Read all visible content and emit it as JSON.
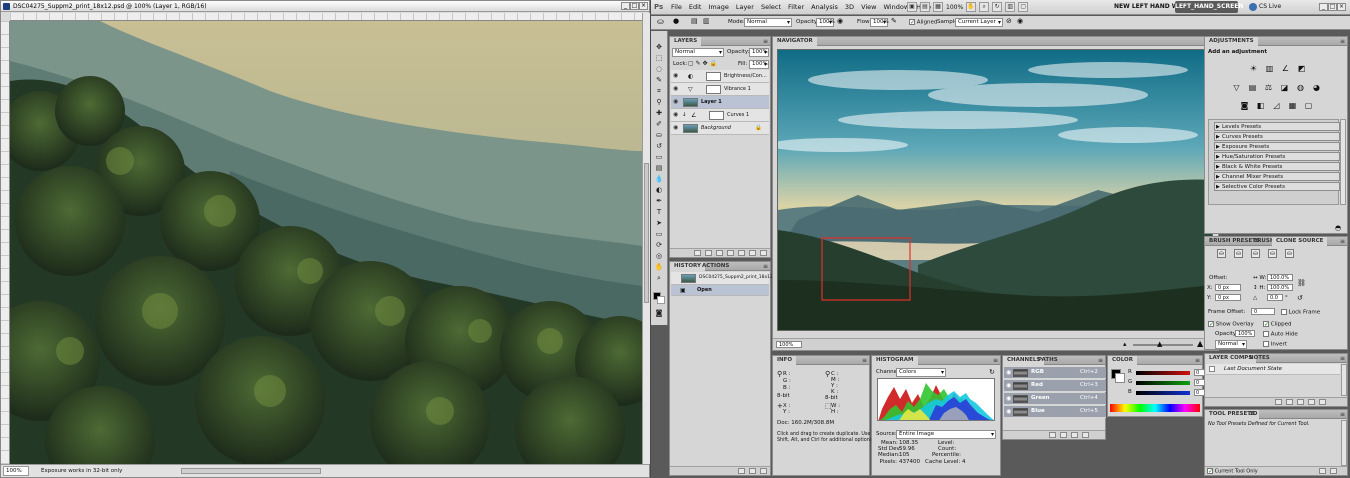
{
  "document": {
    "title": "DSC04275_Suppm2_print_18x12.psd @ 100% (Layer 1, RGB/16)",
    "min_glyph": "_",
    "max_glyph": "□",
    "close_glyph": "×",
    "zoom": "100%",
    "status": "Exposure works in 32-bit only"
  },
  "menubar": {
    "logo": "Ps",
    "items": [
      "File",
      "Edit",
      "Image",
      "Layer",
      "Select",
      "Filter",
      "Analysis",
      "3D",
      "View",
      "Window",
      "Help"
    ],
    "zoom_value": "100%",
    "workspaces": "NEW LEFT HAND WS",
    "active_workspace": "LEFT_HAND_SCREEN",
    "cs_live": "CS Live"
  },
  "options": {
    "mode_label": "Mode:",
    "mode_value": "Normal",
    "opacity_label": "Opacity:",
    "opacity_value": "100%",
    "flow_label": "Flow:",
    "flow_value": "100%",
    "aligned_label": "Aligned",
    "sample_label": "Sample:",
    "sample_value": "Current Layer"
  },
  "layers": {
    "tab": "LAYERS",
    "blend": "Normal",
    "opacity_label": "Opacity:",
    "opacity_value": "100%",
    "lock_label": "Lock:",
    "fill_label": "Fill:",
    "fill_value": "100%",
    "rows": [
      {
        "name": "Brightness/Con..."
      },
      {
        "name": "Vibrance 1"
      },
      {
        "name": "Layer 1"
      },
      {
        "name": "Curves 1"
      },
      {
        "name": "Background"
      }
    ]
  },
  "history": {
    "tab": "HISTORY",
    "tab2": "ACTIONS",
    "snapshot": "DSC04275_Suppm2_print_18x12.psd",
    "state": "Open"
  },
  "navigator": {
    "tab": "NAVIGATOR",
    "zoom": "100%"
  },
  "info": {
    "tab": "INFO",
    "labels": [
      "R :",
      "G :",
      "B :",
      "8-bit",
      "C :",
      "M :",
      "Y :",
      "K :",
      "8-bit",
      "X :",
      "Y :",
      "W :",
      "H :"
    ],
    "doc": "Doc: 160.2M/308.8M",
    "hint": [
      "Click and drag to create duplicate.  Use",
      "Shift, Alt, and Ctrl for additional options."
    ]
  },
  "histogram": {
    "tab": "HISTOGRAM",
    "channel_label": "Channel:",
    "channel_value": "Colors",
    "source_label": "Source:",
    "source_value": "Entire Image",
    "stats_left": [
      [
        "Mean:",
        "108.35"
      ],
      [
        "Std Dev:",
        "59.96"
      ],
      [
        "Median:",
        "105"
      ],
      [
        "Pixels:",
        "437400"
      ]
    ],
    "stats_right": [
      "Level:",
      "Count:",
      "Percentile:",
      "Cache Level:  4"
    ]
  },
  "channels": {
    "tab": "CHANNELS",
    "tab2": "PATHS",
    "rows": [
      {
        "name": "RGB",
        "key": "Ctrl+2"
      },
      {
        "name": "Red",
        "key": "Ctrl+3"
      },
      {
        "name": "Green",
        "key": "Ctrl+4"
      },
      {
        "name": "Blue",
        "key": "Ctrl+5"
      }
    ]
  },
  "color": {
    "tab": "COLOR",
    "labels": [
      "R",
      "G",
      "B"
    ],
    "values": [
      "0",
      "0",
      "0"
    ],
    "colors": {
      "r": "#d01010",
      "g": "#10a010",
      "b": "#1030d0"
    }
  },
  "adjustments": {
    "tab": "ADJUSTMENTS",
    "heading": "Add an adjustment",
    "icons_row1": [
      "☀",
      "▥",
      "∠",
      "◩"
    ],
    "icons_row2": [
      "▽",
      "▤",
      "⚖",
      "◪",
      "◍",
      "◕"
    ],
    "icons_row3": [
      "◙",
      "◧",
      "◿",
      "▦",
      "▢"
    ],
    "presets": [
      "Levels Presets",
      "Curves Presets",
      "Exposure Presets",
      "Hue/Saturation Presets",
      "Black & White Presets",
      "Channel Mixer Presets",
      "Selective Color Presets"
    ]
  },
  "clone_source": {
    "tabs": [
      "BRUSH PRESETS",
      "BRUSH",
      "CLONE SOURCE"
    ],
    "offset_label": "Offset:",
    "x_value": "0 px",
    "y_value": "0 px",
    "w_value": "100.0%",
    "h_value": "100.0%",
    "angle_value": "0.0",
    "frame_offset_label": "Frame Offset:",
    "frame_offset_value": "0",
    "lock_frame": "Lock Frame",
    "show_overlay": "Show Overlay",
    "clipped": "Clipped",
    "opacity_label": "Opacity:",
    "opacity_value": "100%",
    "auto_hide": "Auto Hide",
    "mode_value": "Normal",
    "invert": "Invert"
  },
  "layer_comps": {
    "tabs": [
      "LAYER COMPS",
      "NOTES"
    ],
    "item": "Last Document State"
  },
  "tool_presets": {
    "tabs": [
      "TOOL PRESETS",
      "3D"
    ],
    "message": "No Tool Presets Defined for Current Tool.",
    "current_only": "Current Tool Only"
  }
}
